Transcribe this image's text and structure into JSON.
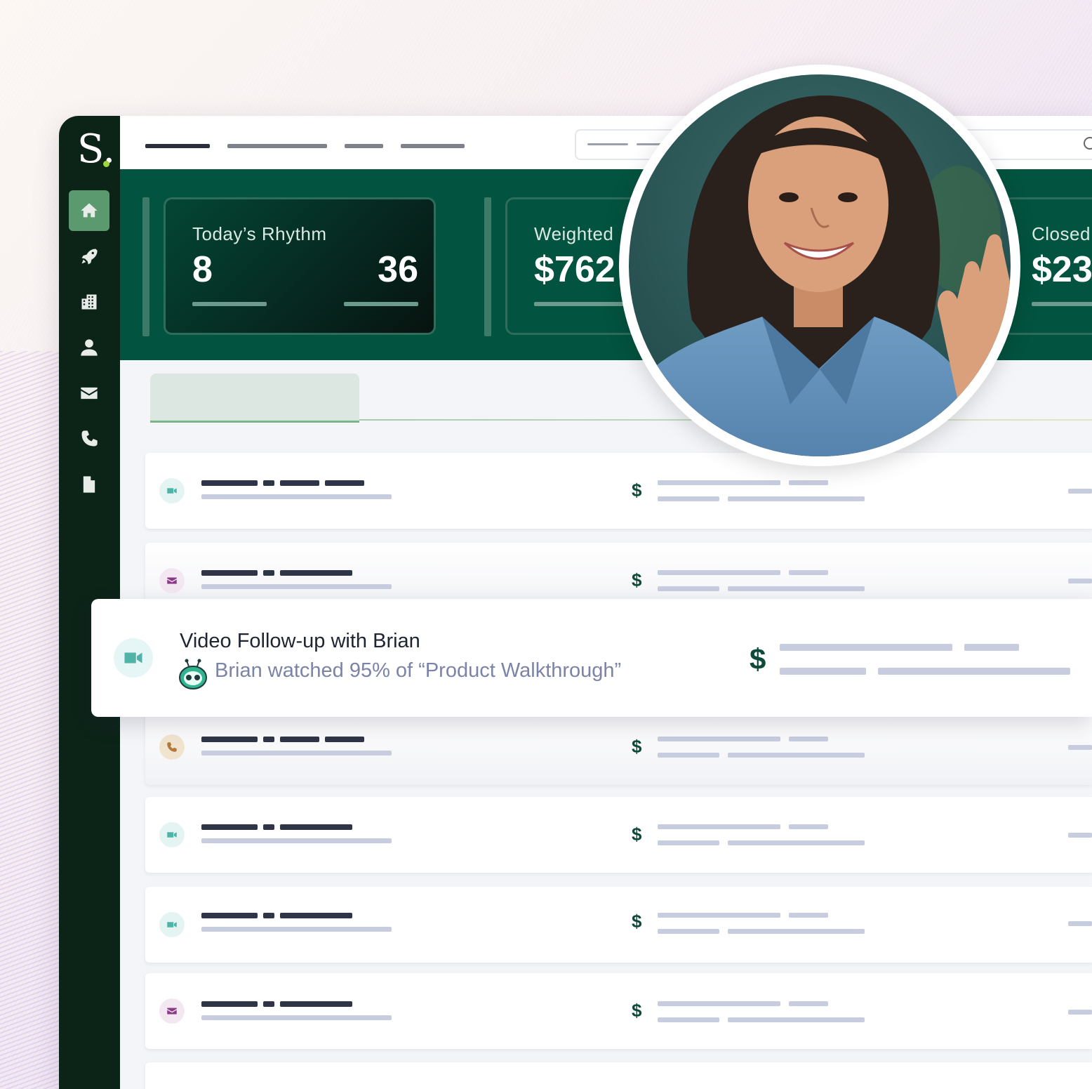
{
  "logo": {
    "letter": "S."
  },
  "sidebar": {
    "items": [
      {
        "icon": "home-icon",
        "active": true
      },
      {
        "icon": "rocket-icon"
      },
      {
        "icon": "building-icon"
      },
      {
        "icon": "user-icon"
      },
      {
        "icon": "mail-icon"
      },
      {
        "icon": "phone-icon"
      },
      {
        "icon": "file-icon"
      }
    ]
  },
  "stats": {
    "rhythm": {
      "label": "Today’s Rhythm",
      "value_a": "8",
      "value_b": "36"
    },
    "weighted": {
      "label": "Weighted",
      "value": "$762"
    },
    "closed": {
      "label": "Closed",
      "value": "$23"
    }
  },
  "highlight": {
    "title": "Video Follow-up with Brian",
    "subtitle": "Brian watched 95% of “Product Walkthrough”",
    "currency": "$"
  },
  "rows": [
    {
      "type": "video"
    },
    {
      "type": "email"
    },
    {
      "type": "phone"
    },
    {
      "type": "video"
    },
    {
      "type": "video"
    },
    {
      "type": "email"
    }
  ],
  "currency_symbol": "$",
  "colors": {
    "brand": "#02533f",
    "sidebar": "#0c2318",
    "active_nav": "#5a9a6e",
    "accent_dot": "#9fd43a",
    "muted_text": "#7b84a8"
  }
}
